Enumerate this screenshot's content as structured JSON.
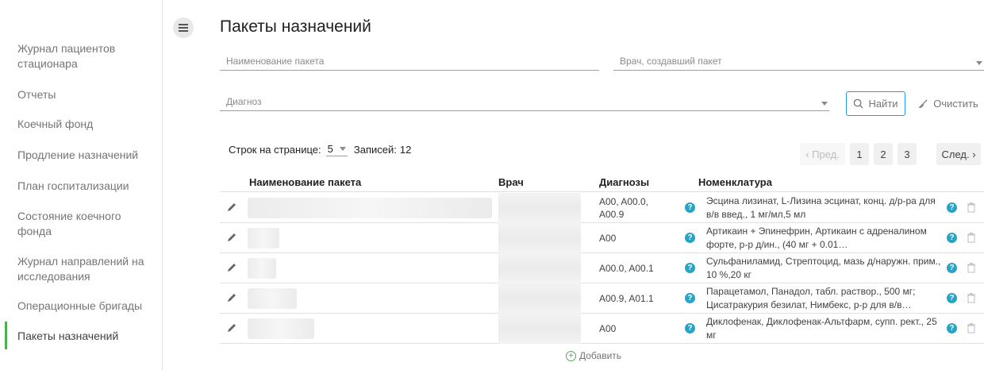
{
  "sidebar": {
    "items": [
      {
        "label": "Журнал пациентов стационара",
        "active": false
      },
      {
        "label": "Отчеты",
        "active": false
      },
      {
        "label": "Коечный фонд",
        "active": false
      },
      {
        "label": "Продление назначений",
        "active": false
      },
      {
        "label": "План госпитализации",
        "active": false
      },
      {
        "label": "Состояние коечного фонда",
        "active": false
      },
      {
        "label": "Журнал направлений на исследования",
        "active": false
      },
      {
        "label": "Операционные бригады",
        "active": false
      },
      {
        "label": "Пакеты назначений",
        "active": true
      }
    ]
  },
  "page": {
    "title": "Пакеты назначений"
  },
  "filters": {
    "package_name_placeholder": "Наименование пакета",
    "doctor_placeholder": "Врач, создавший пакет",
    "diagnosis_placeholder": "Диагноз",
    "find_label": "Найти",
    "clear_label": "Очистить"
  },
  "pagination": {
    "rows_per_page_label": "Строк на странице:",
    "rows_per_page_value": "5",
    "records_label": "Записей:",
    "records_count": "12",
    "prev_label": "‹ Пред.",
    "pages": [
      "1",
      "2",
      "3"
    ],
    "next_label": "След. ›"
  },
  "table": {
    "headers": {
      "name": "Наименование пакета",
      "doctor": "Врач",
      "diagnoses": "Диагнозы",
      "nomenclature": "Номенклатура"
    },
    "rows": [
      {
        "diagnoses": "A00, A00.0, A00.9",
        "nomenclature": "Эсцина лизинат, L-Лизина эсцинат, конц. д/р-ра для в/в введ., 1 мг/мл,5 мл"
      },
      {
        "diagnoses": "A00",
        "nomenclature": "Артикаин + Эпинефрин, Артикаин с адреналином форте, р-р д/ин., (40 мг + 0.01…"
      },
      {
        "diagnoses": "A00.0, A00.1",
        "nomenclature": "Сульфаниламид, Стрептоцид, мазь д/наружн. прим., 10 %,20 кг"
      },
      {
        "diagnoses": "A00.9, A01.1",
        "nomenclature": "Парацетамол, Панадол, табл. раствор., 500 мг; Цисатракурия безилат, Нимбекс, р-р для в/в…"
      },
      {
        "diagnoses": "A00",
        "nomenclature": "Диклофенак, Диклофенак-Альтфарм, супп. рект., 25 мг"
      }
    ]
  },
  "add_label": "Добавить",
  "colors": {
    "accent": "#4caf50",
    "primary": "#2196f3",
    "help": "#29a3c4"
  }
}
